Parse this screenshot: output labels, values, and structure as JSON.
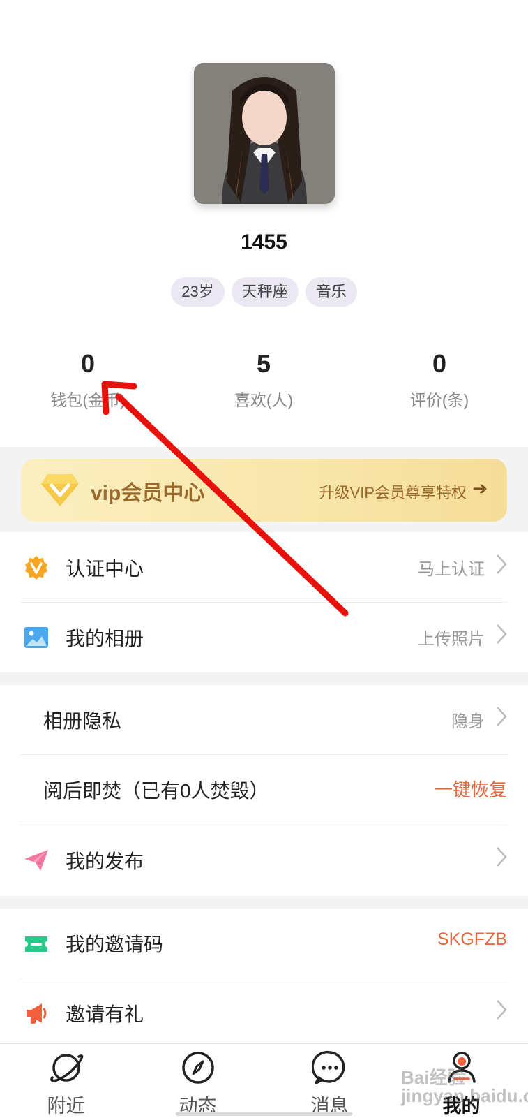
{
  "profile": {
    "username": "1455",
    "tags": [
      "23岁",
      "天秤座",
      "音乐"
    ]
  },
  "stats": [
    {
      "value": "0",
      "label": "钱包(金币)"
    },
    {
      "value": "5",
      "label": "喜欢(人)"
    },
    {
      "value": "0",
      "label": "评价(条)"
    }
  ],
  "vip": {
    "title": "vip会员中心",
    "subtitle": "升级VIP会员尊享特权",
    "arrow": "➔"
  },
  "menu": {
    "verify": {
      "label": "认证中心",
      "right": "马上认证"
    },
    "album": {
      "label": "我的相册",
      "right": "上传照片"
    },
    "album_privacy": {
      "label": "相册隐私",
      "right": "隐身"
    },
    "burn": {
      "label": "阅后即焚（已有0人焚毁）",
      "right": "一键恢复"
    },
    "posts": {
      "label": "我的发布"
    },
    "invite_code": {
      "label": "我的邀请码",
      "right": "SKGFZB"
    },
    "invite_gift": {
      "label": "邀请有礼"
    }
  },
  "tabs": [
    {
      "label": "附近",
      "icon": "planet-icon"
    },
    {
      "label": "动态",
      "icon": "compass-icon"
    },
    {
      "label": "消息",
      "icon": "chat-icon"
    },
    {
      "label": "我的",
      "icon": "user-icon",
      "active": true
    }
  ],
  "watermark": "Bai经验 jingyan.baidu.com",
  "colors": {
    "accent_red": "#e4693e",
    "vip_gold": "#9a6a2c",
    "annotation_arrow": "#e8120c"
  }
}
